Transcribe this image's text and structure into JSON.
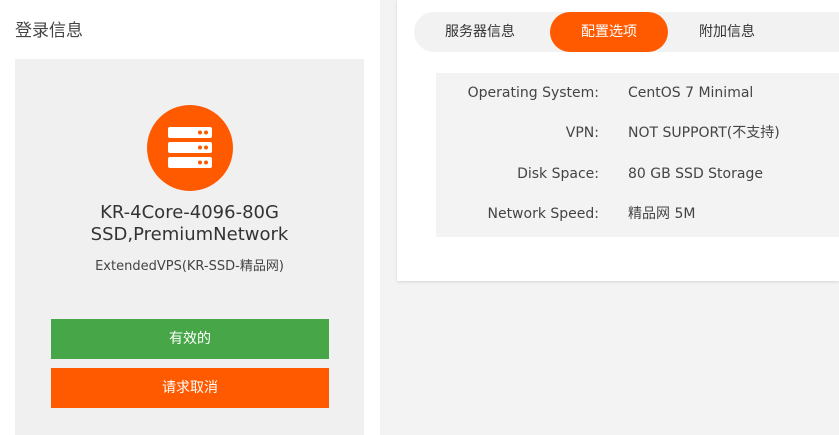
{
  "login_info": {
    "title": "登录信息"
  },
  "product": {
    "name_line1": "KR-4Core-4096-80G",
    "name_line2": "SSD,PremiumNetwork",
    "subtitle": "ExtendedVPS(KR-SSD-精品网)",
    "icon": "server-icon",
    "status_button": "有效的",
    "cancel_button": "请求取消"
  },
  "tabs": [
    {
      "label": "服务器信息",
      "active": false
    },
    {
      "label": "配置选项",
      "active": true
    },
    {
      "label": "附加信息",
      "active": false
    }
  ],
  "specs": [
    {
      "label": "Operating System:",
      "value": "CentOS 7 Minimal"
    },
    {
      "label": "VPN:",
      "value": "NOT SUPPORT(不支持)"
    },
    {
      "label": "Disk Space:",
      "value": "80 GB SSD Storage"
    },
    {
      "label": "Network Speed:",
      "value": "精品网 5M"
    }
  ],
  "colors": {
    "accent": "#ff5a00",
    "success": "#47a647"
  }
}
